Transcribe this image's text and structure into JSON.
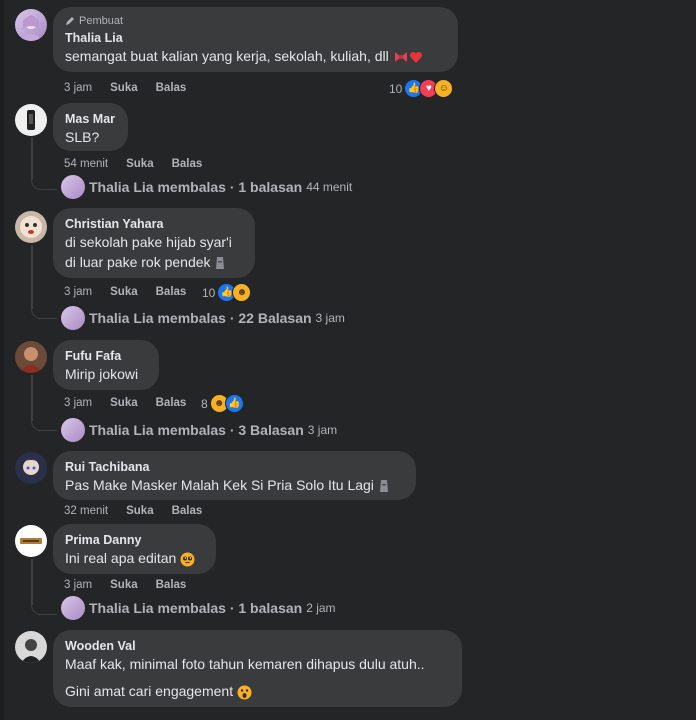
{
  "comments": [
    {
      "author": "Thalia Lia",
      "badge": "Pembuat",
      "text": "semangat buat kalian yang kerja, sekolah, kuliah, dll",
      "time": "3 jam",
      "like": "Suka",
      "reply": "Balas",
      "reactions_count": "10"
    },
    {
      "author": "Mas Mar",
      "text": "SLB?",
      "time": "54 menit",
      "like": "Suka",
      "reply": "Balas",
      "reply_summary": "Thalia Lia membalas · 1 balasan",
      "reply_time": "44 menit"
    },
    {
      "author": "Christian Yahara",
      "text_line1": "di sekolah pake hijab syar'i",
      "text_line2": "di luar pake rok pendek",
      "time": "3 jam",
      "like": "Suka",
      "reply": "Balas",
      "reactions_count": "10",
      "reply_summary": "Thalia Lia membalas · 22 Balasan",
      "reply_time": "3 jam"
    },
    {
      "author": "Fufu Fafa",
      "text": "Mirip jokowi",
      "time": "3 jam",
      "like": "Suka",
      "reply": "Balas",
      "reactions_count": "8",
      "reply_summary": "Thalia Lia membalas · 3 Balasan",
      "reply_time": "3 jam"
    },
    {
      "author": "Rui Tachibana",
      "text": "Pas Make Masker Malah Kek Si Pria Solo Itu Lagi",
      "time": "32 menit",
      "like": "Suka",
      "reply": "Balas"
    },
    {
      "author": "Prima Danny",
      "text": "Ini real apa editan",
      "time": "3 jam",
      "like": "Suka",
      "reply": "Balas",
      "reply_summary": "Thalia Lia membalas · 1 balasan",
      "reply_time": "2 jam"
    },
    {
      "author": "Wooden Val",
      "text_line1": "Maaf kak, minimal foto tahun kemaren dihapus dulu atuh..",
      "text_line2": "Gini amat cari engagement"
    }
  ],
  "icons": {
    "pencil": "pencil-icon",
    "like": "like-reaction-icon",
    "love": "love-reaction-icon",
    "haha": "haha-reaction-icon",
    "care": "care-reaction-icon"
  },
  "colors": {
    "background": "#242526",
    "bubble": "#3a3b3c",
    "secondary_text": "#b0b3b8",
    "like_blue": "#1877f2"
  }
}
